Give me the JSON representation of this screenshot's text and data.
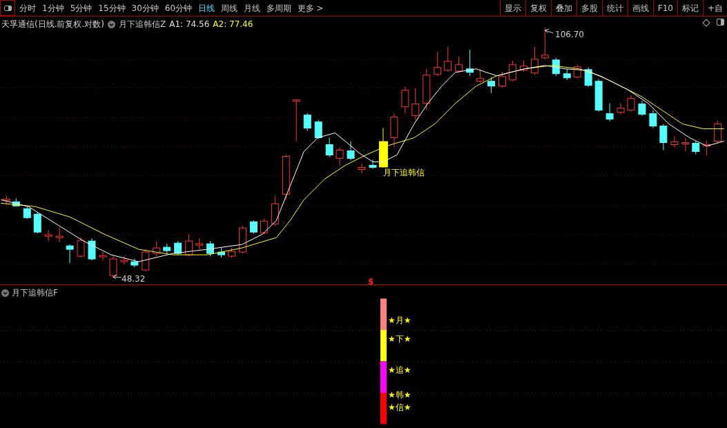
{
  "toolbar": {
    "periods": [
      {
        "label": "分时",
        "selected": false
      },
      {
        "label": "1分钟",
        "selected": false
      },
      {
        "label": "5分钟",
        "selected": false
      },
      {
        "label": "15分钟",
        "selected": false
      },
      {
        "label": "30分钟",
        "selected": false
      },
      {
        "label": "60分钟",
        "selected": false
      },
      {
        "label": "日线",
        "selected": true
      },
      {
        "label": "周线",
        "selected": false
      },
      {
        "label": "月线",
        "selected": false
      },
      {
        "label": "多周期",
        "selected": false
      }
    ],
    "more_label": "更多",
    "more_arrow": ">",
    "tools": [
      "显示",
      "复权",
      "叠加",
      "多股",
      "统计",
      "画线",
      "F10",
      "标记",
      "+自"
    ]
  },
  "main_pane": {
    "stock_title": "天孚通信(日线.前复权.对数)",
    "indicator": "月下追韩信Z",
    "a1": "A1: 74.56",
    "a2": "A2: 77.46",
    "high_label": "106.70",
    "low_label": "48.32",
    "signal_label": "月下追韩信",
    "marker": "$"
  },
  "sub_pane": {
    "indicator": "月下追韩信F",
    "bar_segments": [
      {
        "color": "#ff8080"
      },
      {
        "color": "#ffff00"
      },
      {
        "color": "#ff00ff"
      },
      {
        "color": "#ff0000"
      }
    ],
    "star_labels": [
      "★月★",
      "★下★",
      "★追★",
      "★韩★",
      "★信★"
    ]
  }
}
